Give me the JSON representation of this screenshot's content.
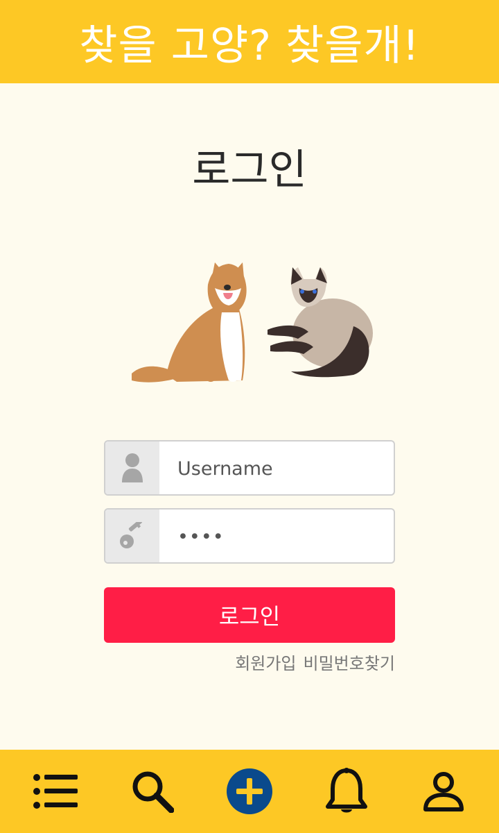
{
  "header": {
    "title": "찾을 고양? 찾을개!"
  },
  "page": {
    "title": "로그인"
  },
  "form": {
    "username": {
      "placeholder": "Username",
      "value": ""
    },
    "password": {
      "value": "••••"
    },
    "submit_label": "로그인"
  },
  "links": {
    "signup": "회원가입",
    "find_password": "비밀번호찾기"
  },
  "bottom_nav": [
    "menu-icon",
    "search-icon",
    "add-icon",
    "bell-icon",
    "user-icon"
  ],
  "colors": {
    "header_bg": "#FDC825",
    "page_bg": "#FEFBEE",
    "primary_button": "#FF1E46",
    "add_button": "#0A4A8C"
  }
}
